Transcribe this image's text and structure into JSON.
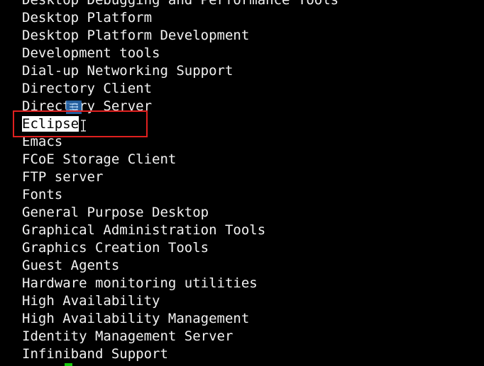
{
  "terminal": {
    "lines": [
      "Desktop Debugging and Performance Tools",
      "Desktop Platform",
      "Desktop Platform Development",
      "Development tools",
      "Dial-up Networking Support",
      "Directory Client",
      "Directory Server",
      "Eclipse",
      "Emacs",
      "FCoE Storage Client",
      "FTP server",
      "Fonts",
      "General Purpose Desktop",
      "Graphical Administration Tools",
      "Graphics Creation Tools",
      "Guest Agents",
      "Hardware monitoring utilities",
      "High Availability",
      "High Availability Management",
      "Identity Management Server",
      "Infiniband Support"
    ],
    "selected_line_index": 7
  },
  "colors": {
    "background": "#000000",
    "text": "#f2f2f2",
    "selection_bg": "#ffffff",
    "selection_text": "#000000",
    "annotation_box": "#e0201f",
    "cursor": "#16c60c"
  }
}
